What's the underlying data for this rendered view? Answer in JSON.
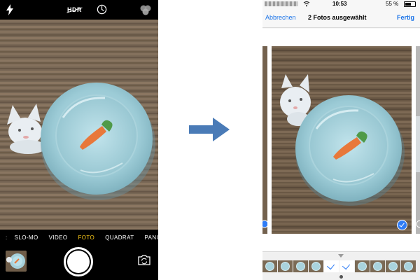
{
  "camera": {
    "hdr_label": "HDR",
    "modes": [
      "SLO-MO",
      "VIDEO",
      "FOTO",
      "QUADRAT",
      "PANO"
    ],
    "selected_mode": "FOTO",
    "accent_color": "#f5c518"
  },
  "photos": {
    "status": {
      "time": "10:53",
      "battery": "55 %"
    },
    "nav": {
      "cancel": "Abbrechen",
      "title": "2 Fotos ausgewählt",
      "done": "Fertig"
    },
    "tint_color": "#1a73e8",
    "selection_color": "#2f7cf6",
    "strip": [
      {
        "selected": false
      },
      {
        "selected": false
      },
      {
        "selected": false
      },
      {
        "selected": false
      },
      {
        "selected": true
      },
      {
        "selected": true
      },
      {
        "selected": false
      },
      {
        "selected": false
      },
      {
        "selected": false
      },
      {
        "selected": false
      }
    ]
  },
  "icons": {
    "flash": "flash-icon",
    "timer": "timer-icon",
    "filters": "filters-icon",
    "switch_camera": "switch-camera-icon",
    "arrow": "right-arrow-icon",
    "checkmark": "checkmark-icon"
  }
}
